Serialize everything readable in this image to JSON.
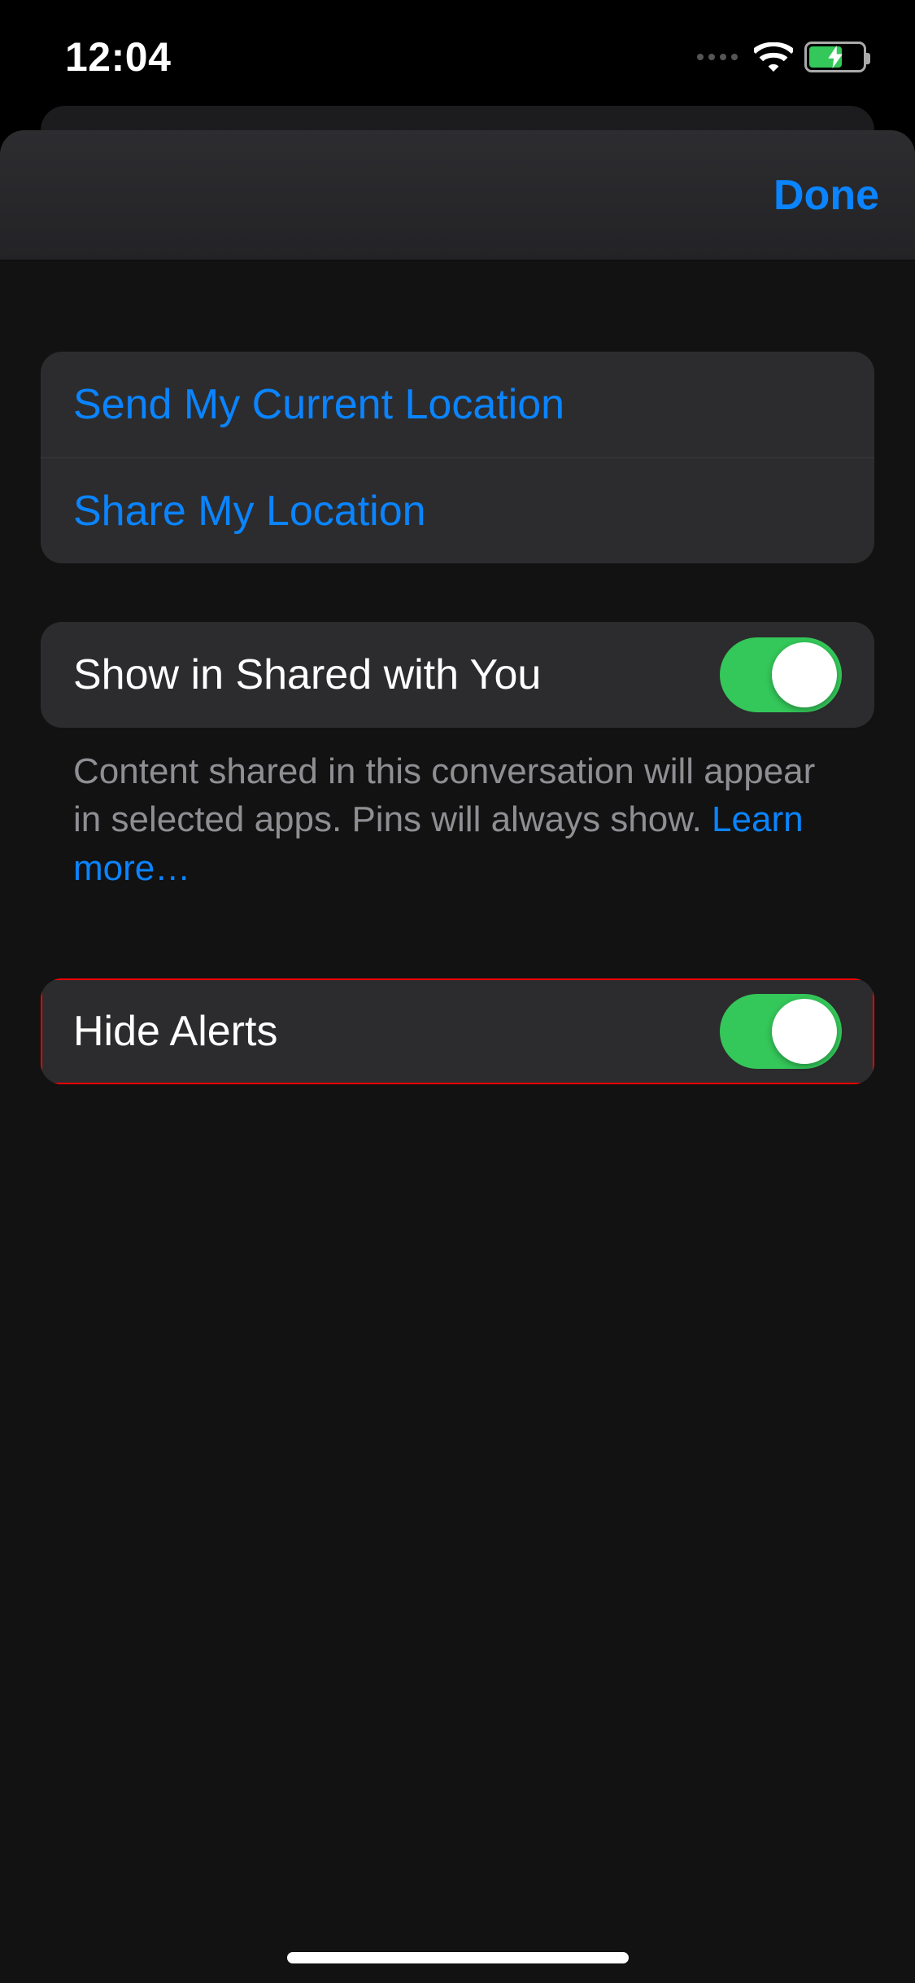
{
  "status": {
    "time": "12:04"
  },
  "header": {
    "done": "Done"
  },
  "location_group": {
    "send_current": "Send My Current Location",
    "share": "Share My Location"
  },
  "shared_group": {
    "label": "Show in Shared with You",
    "toggle_on": true,
    "footer_a": "Content shared in this conversation will appear in selected apps. Pins will always show. ",
    "learn_more": "Learn more…"
  },
  "hide_group": {
    "label": "Hide Alerts",
    "toggle_on": true,
    "highlighted": true
  }
}
